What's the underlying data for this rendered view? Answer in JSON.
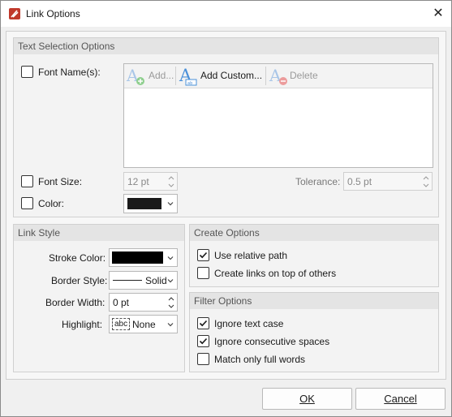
{
  "window": {
    "title": "Link Options",
    "close_glyph": "✕"
  },
  "text_selection": {
    "header": "Text Selection Options",
    "font_names_label": "Font Name(s):",
    "font_names_checked": false,
    "toolbar": {
      "add": "Add...",
      "add_custom": "Add Custom...",
      "delete": "Delete"
    },
    "font_size_label": "Font Size:",
    "font_size_checked": false,
    "font_size_value": "12 pt",
    "tolerance_label": "Tolerance:",
    "tolerance_value": "0.5 pt",
    "color_label": "Color:",
    "color_checked": false,
    "color_swatch": "#1a1a1a"
  },
  "link_style": {
    "header": "Link Style",
    "stroke_color_label": "Stroke Color:",
    "stroke_color": "#000000",
    "border_style_label": "Border Style:",
    "border_style_value": "Solid",
    "border_width_label": "Border Width:",
    "border_width_value": "0 pt",
    "highlight_label": "Highlight:",
    "highlight_badge": "abc",
    "highlight_value": "None"
  },
  "create_options": {
    "header": "Create Options",
    "use_relative_path": {
      "label": "Use relative path",
      "checked": true
    },
    "create_on_top": {
      "label": "Create links on top of others",
      "checked": false
    }
  },
  "filter_options": {
    "header": "Filter Options",
    "ignore_text_case": {
      "label": "Ignore text case",
      "checked": true
    },
    "ignore_consecutive_spaces": {
      "label": "Ignore consecutive spaces",
      "checked": true
    },
    "match_full_words": {
      "label": "Match only full words",
      "checked": false
    }
  },
  "buttons": {
    "ok": "OK",
    "cancel": "Cancel"
  },
  "colors": {
    "accent": "#1f5fbf",
    "check": "#1a1a1a",
    "icon_blue": "#4a90d9",
    "icon_green": "#5cb85c",
    "icon_red": "#e06666",
    "app_red": "#c0392b"
  }
}
